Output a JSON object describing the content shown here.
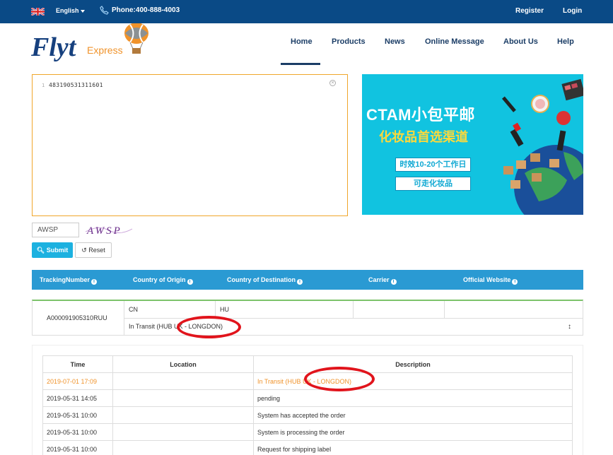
{
  "topbar": {
    "language": "English",
    "phone": "Phone:400-888-4003",
    "register": "Register",
    "login": "Login",
    "flag_icon": "uk-flag-icon",
    "phone_icon": "phone-icon"
  },
  "logo": {
    "word": "Flyt",
    "sub": "Express"
  },
  "nav": {
    "items": [
      "Home",
      "Products",
      "News",
      "Online Message",
      "About Us",
      "Help"
    ],
    "active": "Home"
  },
  "tracking": {
    "line_number": "1",
    "value": "483190531311601"
  },
  "banner": {
    "title": "CTAM小包平邮",
    "subtitle": "化妆品首选渠道",
    "button1": "时效10-20个工作日",
    "button2": "可走化妆品"
  },
  "captcha": {
    "value": "AWSP",
    "image_text": "AWSP"
  },
  "buttons": {
    "submit": "Submit",
    "reset": "Reset"
  },
  "results": {
    "headers": [
      "TrackingNumber",
      "Country of Origin",
      "Country of Destination",
      "Carrier",
      "Official Website"
    ],
    "summary": {
      "tracking_number": "A000091905310RUU",
      "origin": "CN",
      "destination": "HU",
      "status": "In Transit (HUB UK - LONGDON)"
    }
  },
  "detail": {
    "headers": [
      "Time",
      "Location",
      "Description"
    ],
    "rows": [
      {
        "time": "2019-07-01 17:09",
        "location": "",
        "description": "In Transit (HUB UK - LONGDON)"
      },
      {
        "time": "2019-05-31 14:05",
        "location": "",
        "description": "pending"
      },
      {
        "time": "2019-05-31 10:00",
        "location": "",
        "description": "System has accepted the order"
      },
      {
        "time": "2019-05-31 10:00",
        "location": "",
        "description": "System is processing the order"
      },
      {
        "time": "2019-05-31 10:00",
        "location": "",
        "description": "Request for shipping label"
      }
    ]
  },
  "colors": {
    "topbar": "#0a4a86",
    "nav_text": "#1b3d66",
    "accent_orange": "#f0932b",
    "header_blue": "#2a9ad3",
    "banner_cyan": "#11c3e0",
    "annotation_red": "#e1141c"
  }
}
